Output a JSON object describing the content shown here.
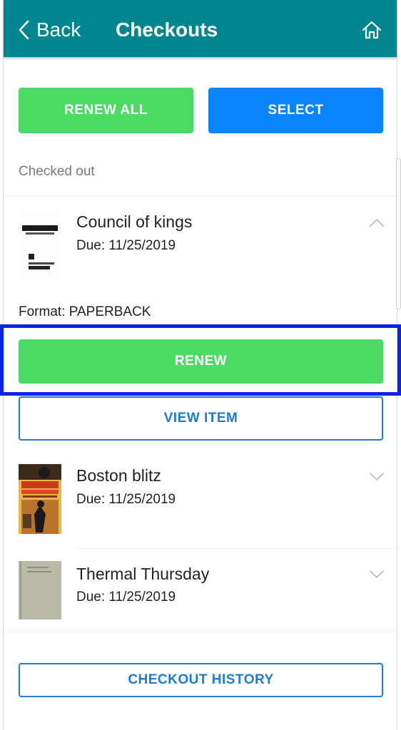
{
  "header": {
    "back_label": "Back",
    "title": "Checkouts"
  },
  "actions": {
    "renew_all": "RENEW ALL",
    "select": "SELECT"
  },
  "section": {
    "label": "Checked out"
  },
  "items": [
    {
      "title": "Council of kings",
      "due": "Due: 11/25/2019",
      "format": "Format: PAPERBACK",
      "expanded": true,
      "renew": "RENEW",
      "view": "VIEW ITEM"
    },
    {
      "title": "Boston blitz",
      "due": "Due: 11/25/2019",
      "expanded": false
    },
    {
      "title": "Thermal Thursday",
      "due": "Due: 11/25/2019",
      "expanded": false
    }
  ],
  "footer": {
    "history": "CHECKOUT HISTORY"
  },
  "colors": {
    "header": "#00868f",
    "green": "#4cd964",
    "blue": "#0a84ff",
    "outline": "#1e7bd6",
    "highlight": "#0a24e6"
  }
}
